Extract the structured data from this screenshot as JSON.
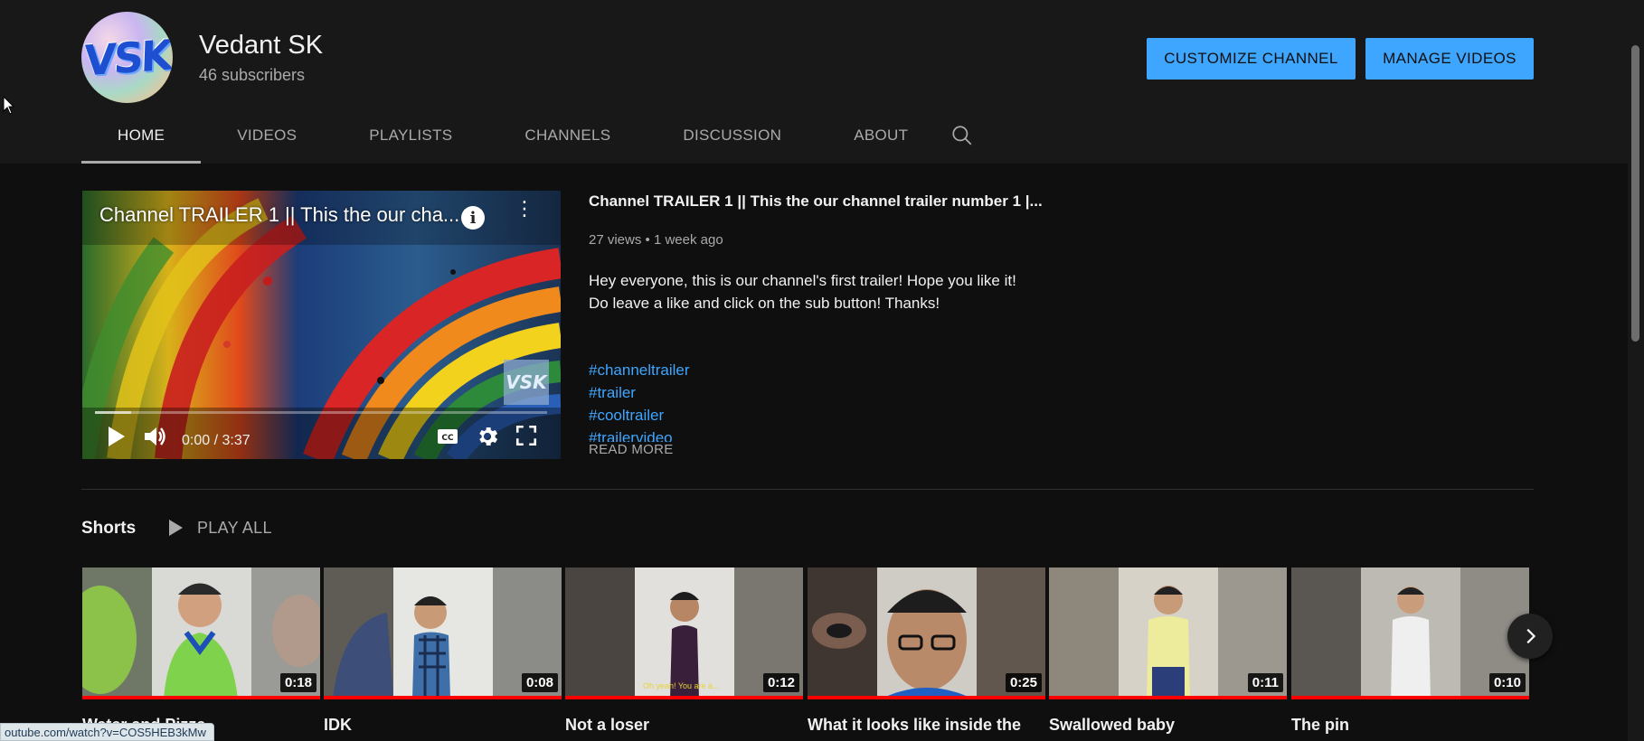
{
  "channel": {
    "name": "Vedant SK",
    "subscribers": "46 subscribers",
    "avatar_text": "VSK"
  },
  "actions": {
    "customize_label": "CUSTOMIZE CHANNEL",
    "manage_label": "MANAGE VIDEOS"
  },
  "tabs": [
    {
      "label": "HOME",
      "active": true
    },
    {
      "label": "VIDEOS",
      "active": false
    },
    {
      "label": "PLAYLISTS",
      "active": false
    },
    {
      "label": "CHANNELS",
      "active": false
    },
    {
      "label": "DISCUSSION",
      "active": false
    },
    {
      "label": "ABOUT",
      "active": false
    }
  ],
  "trailer": {
    "player_title": "Channel TRAILER 1 || This the our cha...",
    "watermark": "VSK",
    "time": "0:00 / 3:37",
    "progress_fraction": 0.08,
    "title": "Channel TRAILER 1 || This the our channel trailer number 1 |...",
    "meta": "27 views • 1 week ago",
    "description_line1": "Hey everyone, this is our channel's first trailer! Hope you like it!",
    "description_line2": "Do leave a like and click on the sub button! Thanks!",
    "hashtags": [
      "#channeltrailer",
      "#trailer",
      "#cooltrailer",
      "#trailervideo"
    ],
    "read_more": "READ MORE"
  },
  "shorts": {
    "heading": "Shorts",
    "play_all": "PLAY ALL",
    "items": [
      {
        "title": "Water and Pizza",
        "duration": "0:18",
        "caption": ""
      },
      {
        "title": "IDK",
        "duration": "0:08",
        "caption": ""
      },
      {
        "title": "Not a loser",
        "duration": "0:12",
        "caption": "Oh yeah! You are a..."
      },
      {
        "title": "What it looks like inside the fridge",
        "duration": "0:25",
        "caption": ""
      },
      {
        "title": "Swallowed baby",
        "duration": "0:11",
        "caption": ""
      },
      {
        "title": "The pin",
        "duration": "0:10",
        "caption": ""
      }
    ]
  },
  "status_bar": {
    "url": "outube.com/watch?v=COS5HEB3kMw"
  },
  "colors": {
    "accent_blue": "#3ea6ff",
    "background": "#0f0f0f",
    "header_bg": "#181818",
    "progress_red": "#ff0000"
  },
  "icons": {
    "search": "search-icon",
    "play": "play-icon",
    "volume": "volume-icon",
    "captions": "cc-icon",
    "settings": "gear-icon",
    "fullscreen": "fullscreen-icon",
    "info": "info-icon",
    "more": "more-vert-icon",
    "next": "chevron-right-icon"
  }
}
